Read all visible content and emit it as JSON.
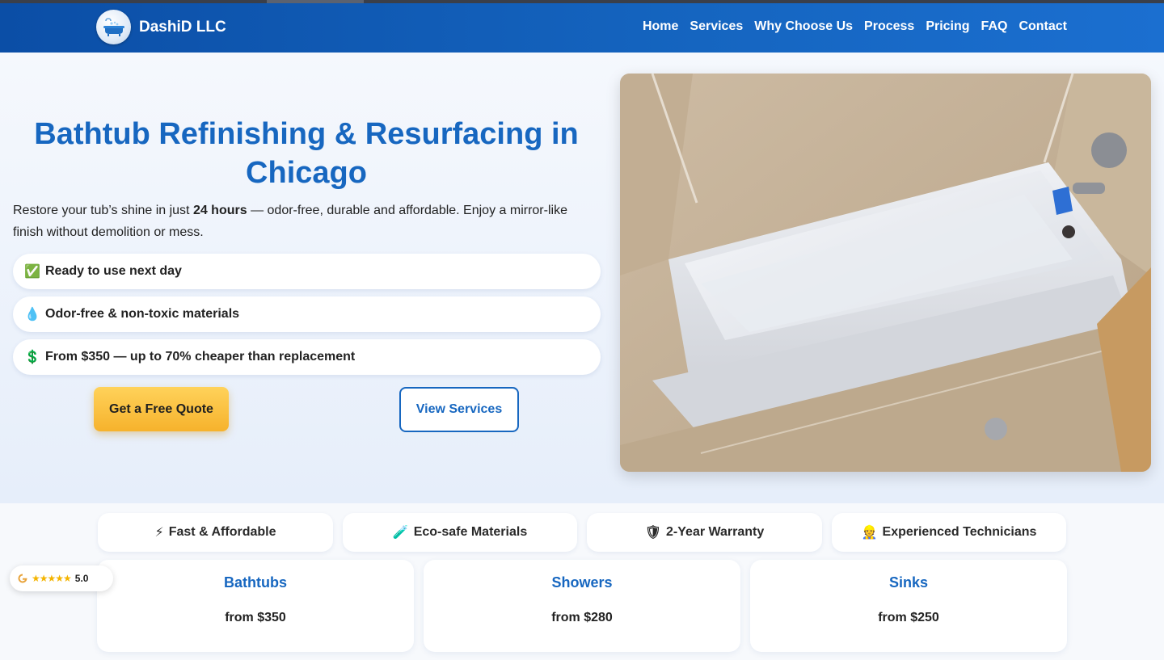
{
  "header": {
    "brand": "DashiD LLC",
    "logo_icon": "bathtub-icon",
    "nav": [
      "Home",
      "Services",
      "Why Choose Us",
      "Process",
      "Pricing",
      "FAQ",
      "Contact"
    ]
  },
  "hero": {
    "title": "Bathtub Refinishing & Resurfacing in Chicago",
    "lead_before": "Restore your tub’s shine in just ",
    "lead_bold": "24 hours",
    "lead_after": " — odor-free, durable and affordable. Enjoy a mirror-like finish without demolition or mess.",
    "features": [
      {
        "icon": "check-icon",
        "glyph": "✅",
        "text": "Ready to use next day"
      },
      {
        "icon": "droplet-icon",
        "glyph": "💧",
        "text": "Odor-free & non-toxic materials"
      },
      {
        "icon": "dollar-icon",
        "glyph": "💲",
        "text": "From $350 — up to 70% cheaper than replacement"
      }
    ],
    "primary_button": "Get a Free Quote",
    "secondary_button": "View Services"
  },
  "badges": [
    {
      "icon": "lightning-icon",
      "glyph": "⚡",
      "text": "Fast & Affordable"
    },
    {
      "icon": "test-tube-icon",
      "glyph": "🧪",
      "text": "Eco-safe Materials"
    },
    {
      "icon": "shield-icon",
      "glyph": "🛡",
      "text": "2-Year Warranty"
    },
    {
      "icon": "technician-icon",
      "glyph": "👷",
      "text": "Experienced Technicians"
    }
  ],
  "pricing_cards": [
    {
      "title": "Bathtubs",
      "price": "from $350"
    },
    {
      "title": "Showers",
      "price": "from $280"
    },
    {
      "title": "Sinks",
      "price": "from $250"
    }
  ],
  "rating": {
    "stars": "★★★★★",
    "score": "5.0",
    "icon": "google-icon"
  },
  "colors": {
    "brand_blue": "#1767c0",
    "header_blue": "#0b4ea6",
    "cta_yellow": "#f6b22c"
  }
}
